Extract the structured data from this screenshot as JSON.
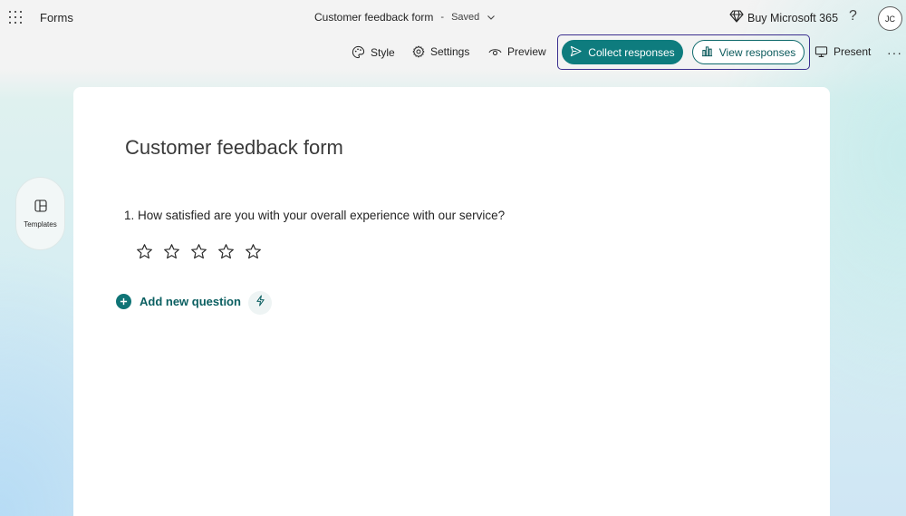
{
  "header": {
    "app_name": "Forms",
    "doc_title": "Customer feedback form",
    "separator": "-",
    "save_status": "Saved",
    "buy_label": "Buy Microsoft 365",
    "help_label": "?",
    "avatar_initials": "JC"
  },
  "commands": {
    "style": "Style",
    "settings": "Settings",
    "preview": "Preview",
    "collect": "Collect responses",
    "view": "View responses",
    "present": "Present",
    "more": "···"
  },
  "sidebar": {
    "templates_label": "Templates"
  },
  "form": {
    "title": "Customer feedback form",
    "questions": [
      {
        "text": "1. How satisfied are you with your overall experience with our service?",
        "type": "rating",
        "star_count": 5
      }
    ],
    "add_question_label": "Add new question"
  },
  "colors": {
    "accent": "#0e7c7e",
    "focus_ring": "#3b2f8f"
  },
  "icons": {
    "app_launcher": "waffle-icon",
    "chevron": "chevron-down-icon",
    "diamond": "diamond-icon",
    "style": "palette-icon",
    "settings": "gear-icon",
    "preview": "eye-icon",
    "send": "send-icon",
    "chart": "bar-chart-icon",
    "present": "monitor-icon",
    "templates": "templates-icon",
    "star": "star-icon",
    "add": "plus-circle-icon",
    "copilot": "lightning-icon"
  }
}
